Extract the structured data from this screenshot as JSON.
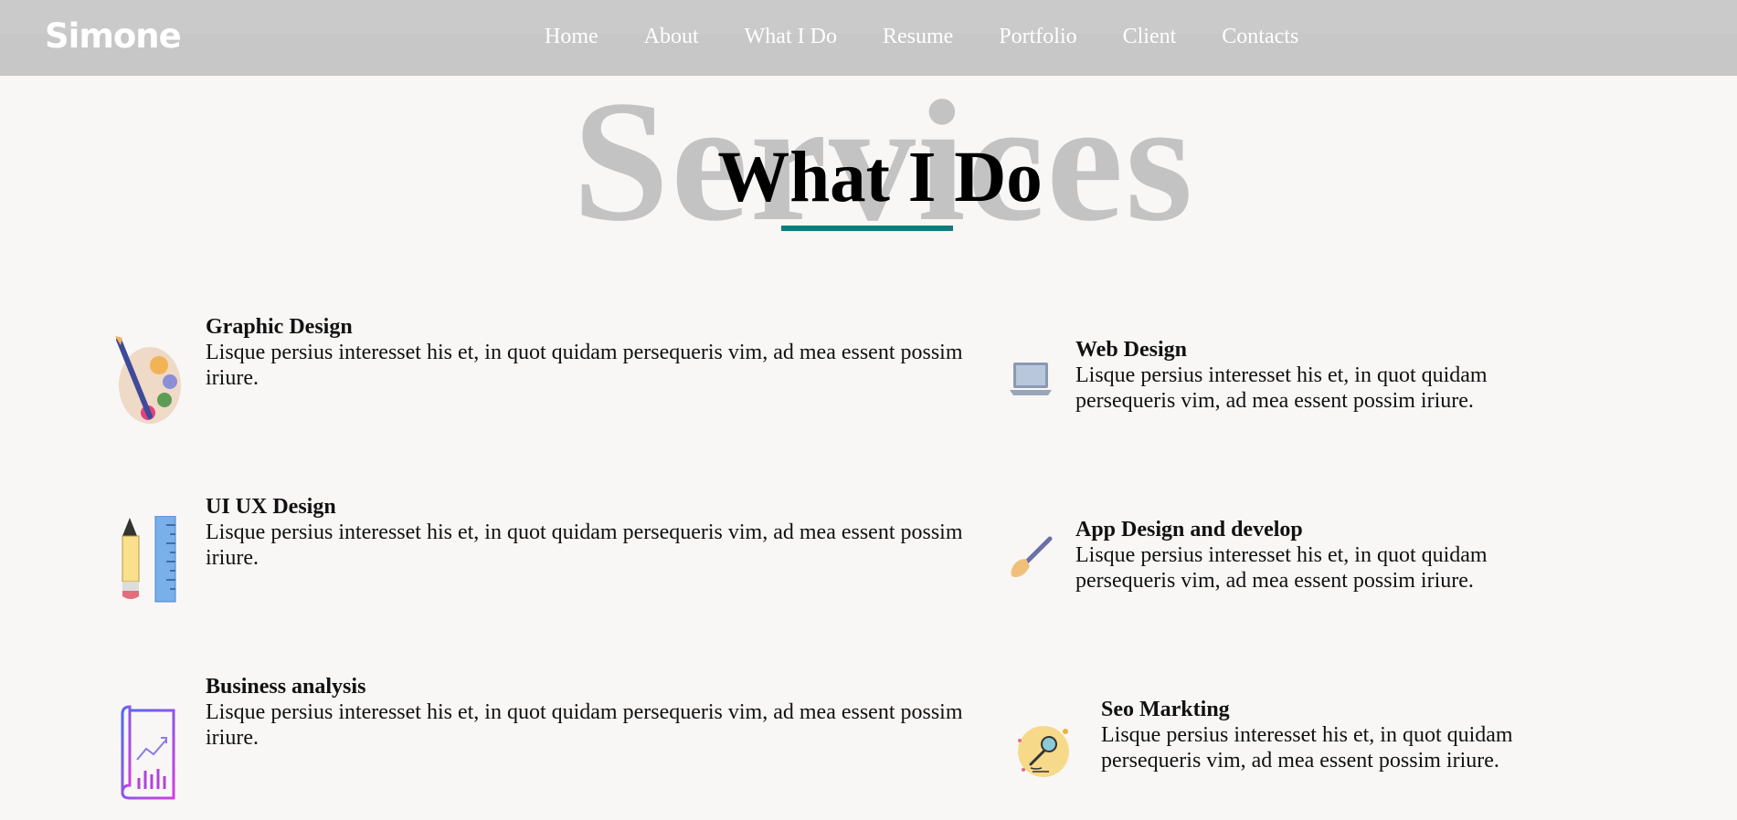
{
  "brand": "Simone",
  "nav": [
    "Home",
    "About",
    "What I Do",
    "Resume",
    "Portfolio",
    "Client",
    "Contacts"
  ],
  "section": {
    "bg_title": "Services",
    "title": "What I Do",
    "accent": "#137b7b"
  },
  "services": [
    {
      "title": "Graphic Design",
      "text": "Lisque persius interesset his et, in quot quidam persequeris vim, ad mea essent possim iriure.",
      "icon": "palette-icon"
    },
    {
      "title": "Web Design",
      "text": "Lisque persius interesset his et, in quot quidam persequeris vim, ad mea essent possim iriure.",
      "icon": "laptop-icon"
    },
    {
      "title": "UI UX Design",
      "text": "Lisque persius interesset his et, in quot quidam persequeris vim, ad mea essent possim iriure.",
      "icon": "pencil-ruler-icon"
    },
    {
      "title": "App Design and develop",
      "text": "Lisque persius interesset his et, in quot quidam persequeris vim, ad mea essent possim iriure.",
      "icon": "brush-icon"
    },
    {
      "title": "Business analysis",
      "text": "Lisque persius interesset his et, in quot quidam persequeris vim, ad mea essent possim iriure.",
      "icon": "chart-book-icon"
    },
    {
      "title": "Seo Markting",
      "text": "Lisque persius interesset his et, in quot quidam persequeris vim, ad mea essent possim iriure.",
      "icon": "microphone-icon"
    }
  ]
}
